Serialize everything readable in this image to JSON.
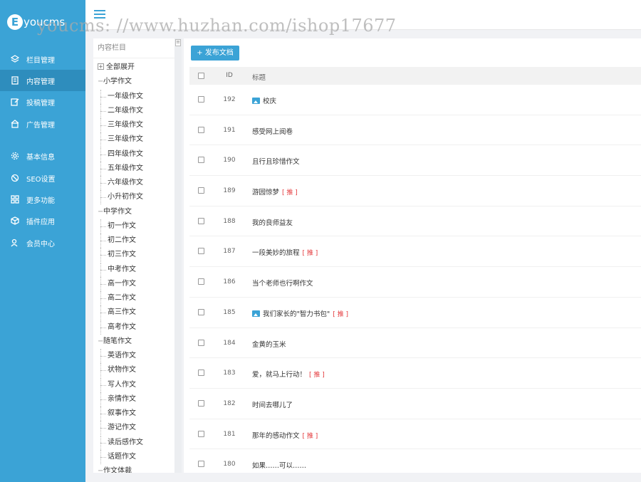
{
  "logo": {
    "mark": "E",
    "text": "youcms"
  },
  "watermark": "youcms: //www.huzhan.com/ishop17677",
  "sidebar": {
    "items": [
      {
        "label": "栏目管理",
        "icon": "layers-icon",
        "active": false
      },
      {
        "label": "内容管理",
        "icon": "document-icon",
        "active": true
      },
      {
        "label": "投稿管理",
        "icon": "edit-icon",
        "active": false
      },
      {
        "label": "广告管理",
        "icon": "ad-icon",
        "active": false
      },
      {
        "label": "基本信息",
        "icon": "gear-icon",
        "active": false
      },
      {
        "label": "SEO设置",
        "icon": "seo-icon",
        "active": false
      },
      {
        "label": "更多功能",
        "icon": "grid-icon",
        "active": false
      },
      {
        "label": "插件应用",
        "icon": "cube-icon",
        "active": false
      },
      {
        "label": "会员中心",
        "icon": "user-icon",
        "active": false
      }
    ]
  },
  "tree": {
    "title": "内容栏目",
    "expand_all": "全部展开",
    "groups": [
      {
        "label": "小学作文",
        "children": [
          "一年级作文",
          "二年级作文",
          "三年级作文",
          "三年级作文",
          "四年级作文",
          "五年级作文",
          "六年级作文",
          "小升初作文"
        ]
      },
      {
        "label": "中学作文",
        "children": [
          "初一作文",
          "初二作文",
          "初三作文",
          "中考作文",
          "高一作文",
          "高二作文",
          "高三作文",
          "高考作文"
        ]
      },
      {
        "label": "随笔作文",
        "children": [
          "英语作文",
          "状物作文",
          "写人作文",
          "亲情作文",
          "叙事作文",
          "游记作文",
          "读后感作文",
          "话题作文"
        ]
      },
      {
        "label": "作文体裁",
        "children": []
      }
    ]
  },
  "main": {
    "add_button": "+ 发布文档",
    "headers": {
      "id": "ID",
      "title": "标题"
    },
    "rows": [
      {
        "id": "192",
        "title": "校庆",
        "has_image": true,
        "recommended": false
      },
      {
        "id": "191",
        "title": "感受网上阅卷",
        "has_image": false,
        "recommended": false
      },
      {
        "id": "190",
        "title": "且行且珍惜作文",
        "has_image": false,
        "recommended": false
      },
      {
        "id": "189",
        "title": "游园惊梦",
        "has_image": false,
        "recommended": true
      },
      {
        "id": "188",
        "title": "我的良师益友",
        "has_image": false,
        "recommended": false
      },
      {
        "id": "187",
        "title": "一段美妙的旅程",
        "has_image": false,
        "recommended": true
      },
      {
        "id": "186",
        "title": "当个老师也行啊作文",
        "has_image": false,
        "recommended": false
      },
      {
        "id": "185",
        "title": "我们家长的\"智力书包\"",
        "has_image": true,
        "recommended": true
      },
      {
        "id": "184",
        "title": "金黄的玉米",
        "has_image": false,
        "recommended": false
      },
      {
        "id": "183",
        "title": "爱，就马上行动！",
        "has_image": false,
        "recommended": true
      },
      {
        "id": "182",
        "title": "时间去哪儿了",
        "has_image": false,
        "recommended": false
      },
      {
        "id": "181",
        "title": "那年的感动作文",
        "has_image": false,
        "recommended": true
      },
      {
        "id": "180",
        "title": "如果……可以……",
        "has_image": false,
        "recommended": false
      }
    ],
    "recommend_tag": "[ 推 ]"
  }
}
